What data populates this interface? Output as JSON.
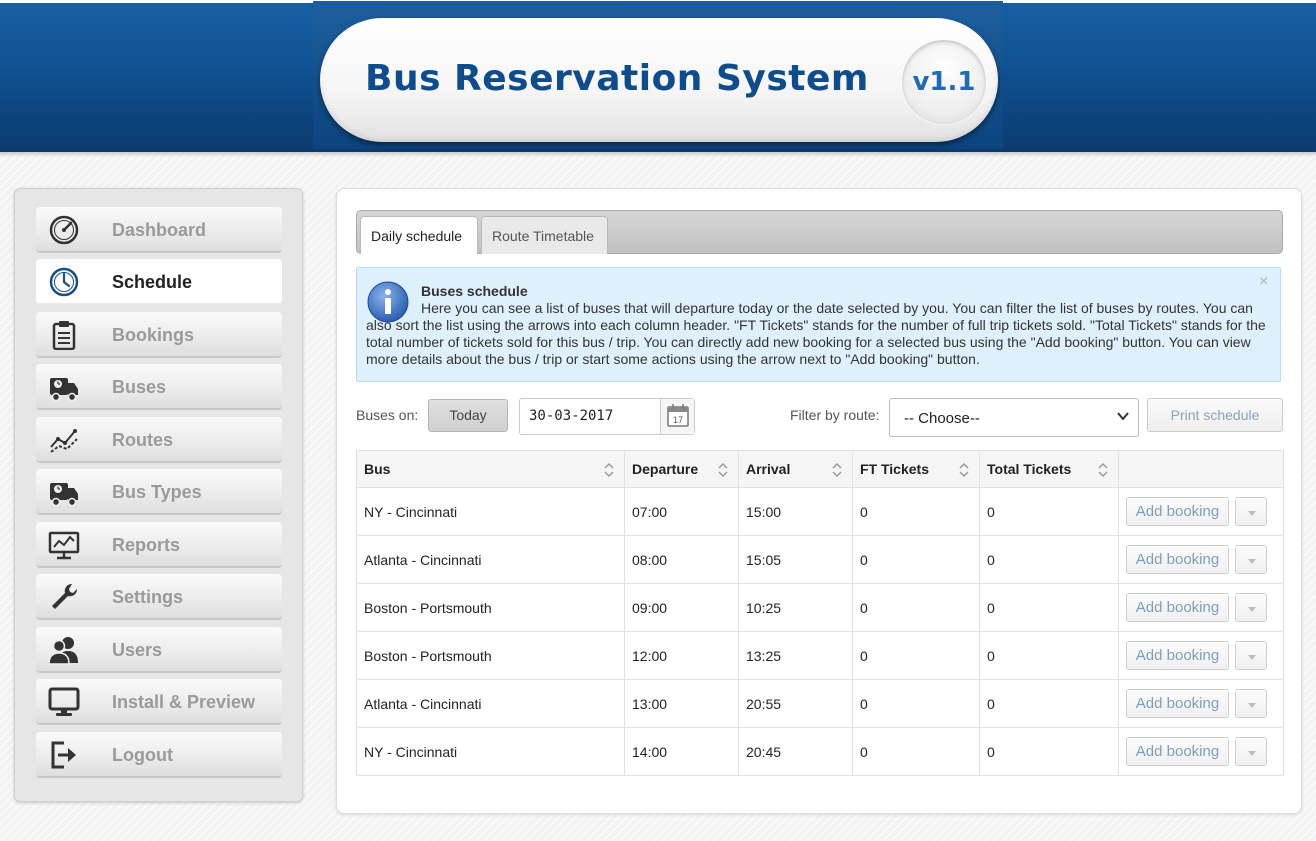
{
  "app": {
    "title": "Bus Reservation System",
    "version": "v1.1"
  },
  "sidebar": {
    "items": [
      {
        "label": "Dashboard",
        "icon": "dashboard-icon"
      },
      {
        "label": "Schedule",
        "icon": "clock-icon",
        "active": true
      },
      {
        "label": "Bookings",
        "icon": "clipboard-icon"
      },
      {
        "label": "Buses",
        "icon": "bus-icon"
      },
      {
        "label": "Routes",
        "icon": "routes-icon"
      },
      {
        "label": "Bus Types",
        "icon": "bus-icon"
      },
      {
        "label": "Reports",
        "icon": "chart-board-icon"
      },
      {
        "label": "Settings",
        "icon": "wrench-icon"
      },
      {
        "label": "Users",
        "icon": "users-icon"
      },
      {
        "label": "Install & Preview",
        "icon": "monitor-icon"
      },
      {
        "label": "Logout",
        "icon": "logout-icon"
      }
    ]
  },
  "tabs": [
    {
      "label": "Daily schedule",
      "active": true
    },
    {
      "label": "Route Timetable",
      "active": false
    }
  ],
  "info": {
    "title": "Buses schedule",
    "text": "Here you can see a list of buses that will departure today or the date selected by you. You can filter the list of buses by routes. You can also sort the list using the arrows into each column header. \"FT Tickets\" stands for the number of full trip tickets sold. \"Total Tickets\" stands for the total number of tickets sold for this bus / trip. You can directly add new booking for a selected bus using the \"Add booking\" button. You can view more details about the bus / trip or start some actions using the arrow next to \"Add booking\" button.",
    "close": "×"
  },
  "toolbar": {
    "buses_on_label": "Buses on:",
    "today_label": "Today",
    "date_value": "30-03-2017",
    "calendar_day": "17",
    "filter_label": "Filter by route:",
    "route_selected": "-- Choose--",
    "print_label": "Print schedule"
  },
  "table": {
    "columns": [
      "Bus",
      "Departure",
      "Arrival",
      "FT Tickets",
      "Total Tickets"
    ],
    "rows": [
      {
        "bus": "NY - Cincinnati",
        "departure": "07:00",
        "arrival": "15:00",
        "ft": "0",
        "total": "0"
      },
      {
        "bus": "Atlanta - Cincinnati",
        "departure": "08:00",
        "arrival": "15:05",
        "ft": "0",
        "total": "0"
      },
      {
        "bus": "Boston - Portsmouth",
        "departure": "09:00",
        "arrival": "10:25",
        "ft": "0",
        "total": "0"
      },
      {
        "bus": "Boston - Portsmouth",
        "departure": "12:00",
        "arrival": "13:25",
        "ft": "0",
        "total": "0"
      },
      {
        "bus": "Atlanta - Cincinnati",
        "departure": "13:00",
        "arrival": "20:55",
        "ft": "0",
        "total": "0"
      },
      {
        "bus": "NY - Cincinnati",
        "departure": "14:00",
        "arrival": "20:45",
        "ft": "0",
        "total": "0"
      }
    ],
    "add_booking_label": "Add booking"
  },
  "colors": {
    "header_blue": "#0f4f8f",
    "title_blue": "#0e4c8c",
    "info_bg": "#def0fb",
    "link_blue": "#7a9ec0"
  }
}
